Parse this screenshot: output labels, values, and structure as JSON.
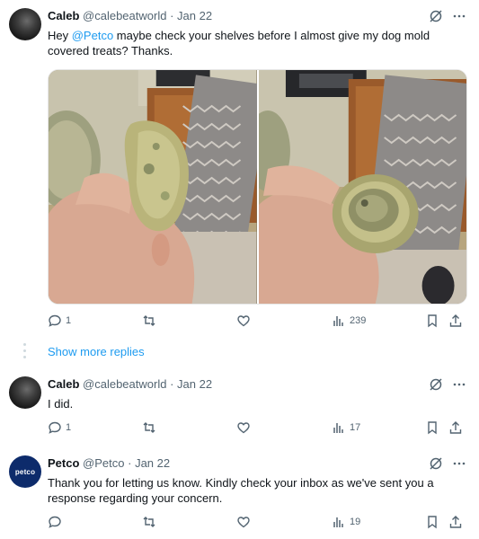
{
  "tweets": [
    {
      "name": "Caleb",
      "handle": "@calebeatworld",
      "dot": "·",
      "date": "Jan 22",
      "text_pre": "Hey ",
      "mention": "@Petco",
      "text_post": " maybe check your shelves before I almost give my dog mold covered treats? Thanks.",
      "replies": "1",
      "retweets": "",
      "likes": "",
      "views": "239"
    },
    {
      "name": "Caleb",
      "handle": "@calebeatworld",
      "dot": "·",
      "date": "Jan 22",
      "text": "I did.",
      "replies": "1",
      "retweets": "",
      "likes": "",
      "views": "17"
    },
    {
      "name": "Petco",
      "handle": "@Petco",
      "dot": "·",
      "date": "Jan 22",
      "avatar_text": "petco",
      "text": "Thank you for letting us know. Kindly check your inbox as we've sent you a response regarding your concern.",
      "replies": "",
      "retweets": "",
      "likes": "",
      "views": "19"
    }
  ],
  "show_more_replies": "Show more replies",
  "colors": {
    "accent": "#1d9bf0",
    "muted": "#536471",
    "text": "#0f1419",
    "petco_navy": "#0d2b6b"
  },
  "icons": [
    "grok-icon",
    "more-icon",
    "reply-icon",
    "retweet-icon",
    "like-icon",
    "views-icon",
    "bookmark-icon",
    "share-icon"
  ]
}
